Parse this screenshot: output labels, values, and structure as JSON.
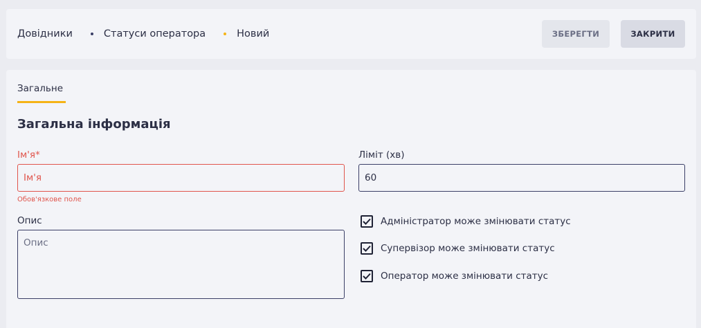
{
  "breadcrumb": {
    "items": [
      "Довідники",
      "Статуси оператора",
      "Новий"
    ]
  },
  "toolbar": {
    "save_label": "ЗБЕРЕГТИ",
    "close_label": "ЗАКРИТИ"
  },
  "tabs": [
    {
      "label": "Загальне",
      "active": true
    }
  ],
  "section": {
    "title": "Загальна інформація"
  },
  "form": {
    "name": {
      "label": "Ім'я*",
      "placeholder": "Ім'я",
      "value": "",
      "error": "Обов'язкове поле"
    },
    "limit": {
      "label": "Ліміт (хв)",
      "value": "60"
    },
    "description": {
      "label": "Опис",
      "placeholder": "Опис",
      "value": ""
    },
    "checkboxes": [
      {
        "label": "Адміністратор може змінювати статус",
        "checked": true
      },
      {
        "label": "Супервізор може змінювати статус",
        "checked": true
      },
      {
        "label": "Оператор може змінювати статус",
        "checked": true
      }
    ]
  },
  "colors": {
    "accent": "#f5b316",
    "error": "#e0544b",
    "text": "#2c2f45",
    "border": "#3a3e66"
  }
}
